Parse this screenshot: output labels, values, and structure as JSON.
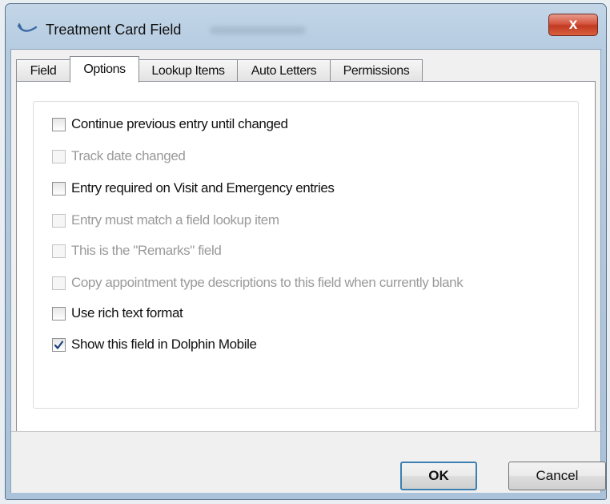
{
  "window": {
    "title": "Treatment Card Field",
    "close_glyph": "x"
  },
  "tabs": [
    {
      "label": "Field",
      "active": false
    },
    {
      "label": "Options",
      "active": true
    },
    {
      "label": "Lookup Items",
      "active": false
    },
    {
      "label": "Auto Letters",
      "active": false
    },
    {
      "label": "Permissions",
      "active": false
    }
  ],
  "options": [
    {
      "label": "Continue previous entry until changed",
      "checked": false,
      "enabled": true
    },
    {
      "label": "Track date changed",
      "checked": false,
      "enabled": false
    },
    {
      "label": "Entry required on Visit and Emergency entries",
      "checked": false,
      "enabled": true
    },
    {
      "label": "Entry must match a field lookup item",
      "checked": false,
      "enabled": false
    },
    {
      "label": "This is the \"Remarks\" field",
      "checked": false,
      "enabled": false
    },
    {
      "label": "Copy appointment type descriptions to this field when currently blank",
      "checked": false,
      "enabled": false
    },
    {
      "label": "Use rich text format",
      "checked": false,
      "enabled": true
    },
    {
      "label": "Show this field in Dolphin Mobile",
      "checked": true,
      "enabled": true
    }
  ],
  "buttons": {
    "ok": "OK",
    "cancel": "Cancel"
  },
  "colors": {
    "title_bar": "#b5cbe0",
    "close_button": "#c13a22",
    "ok_focus_border": "#3c7fb1",
    "check_mark": "#1e3f7a"
  }
}
